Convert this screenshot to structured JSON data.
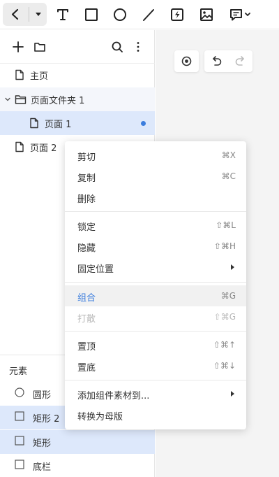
{
  "pages": {
    "items": [
      {
        "label": "主页"
      },
      {
        "label": "页面文件夹 1"
      },
      {
        "label": "页面 1"
      },
      {
        "label": "页面 2"
      }
    ]
  },
  "elements": {
    "title": "元素",
    "items": [
      {
        "label": "圆形"
      },
      {
        "label": "矩形 2"
      },
      {
        "label": "矩形"
      },
      {
        "label": "底栏"
      }
    ]
  },
  "context_menu": {
    "items": [
      {
        "label": "剪切",
        "shortcut": "⌘X"
      },
      {
        "label": "复制",
        "shortcut": "⌘C"
      },
      {
        "label": "删除",
        "shortcut": ""
      },
      {
        "label": "锁定",
        "shortcut": "⇧⌘L"
      },
      {
        "label": "隐藏",
        "shortcut": "⇧⌘H"
      },
      {
        "label": "固定位置",
        "shortcut": ""
      },
      {
        "label": "组合",
        "shortcut": "⌘G"
      },
      {
        "label": "打散",
        "shortcut": "⇧⌘G"
      },
      {
        "label": "置顶",
        "shortcut": "⇧⌘↑"
      },
      {
        "label": "置底",
        "shortcut": "⇧⌘↓"
      },
      {
        "label": "添加组件素材到...",
        "shortcut": ""
      },
      {
        "label": "转换为母版",
        "shortcut": ""
      }
    ]
  },
  "icons": {
    "toolbar": [
      "back-icon",
      "dropdown-icon",
      "text-tool-icon",
      "rectangle-tool-icon",
      "ellipse-tool-icon",
      "line-tool-icon",
      "hotspot-tool-icon",
      "image-tool-icon",
      "comment-tool-icon"
    ],
    "panel": [
      "add-icon",
      "folder-icon",
      "search-icon",
      "more-icon"
    ],
    "canvas": [
      "target-icon",
      "undo-icon",
      "redo-icon"
    ]
  },
  "colors": {
    "accent": "#3b7ddd",
    "selection": "#dde8fb"
  }
}
